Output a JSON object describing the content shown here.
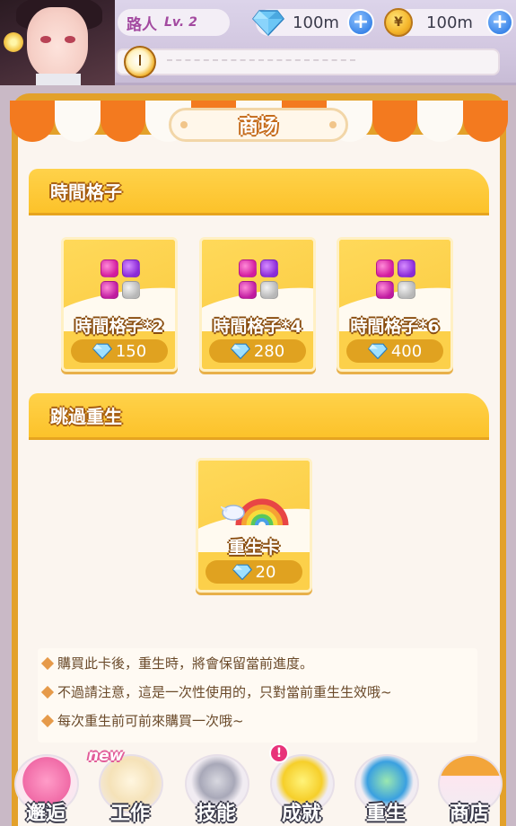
{
  "header": {
    "player_name": "路人",
    "level": "Lv. 2",
    "gems": "100m",
    "coins": "100m"
  },
  "shop": {
    "title": "商场",
    "sections": [
      {
        "title": "時間格子",
        "items": [
          {
            "name": "時間格子*2",
            "price": "150"
          },
          {
            "name": "時間格子*4",
            "price": "280"
          },
          {
            "name": "時間格子*6",
            "price": "400"
          }
        ]
      },
      {
        "title": "跳過重生",
        "items": [
          {
            "name": "重生卡",
            "price": "20"
          }
        ]
      }
    ],
    "notes": [
      "購買此卡後，重生時，將會保留當前進度。",
      "不過請注意，這是一次性使用的，只對當前重生生效哦~",
      "每次重生前可前來購買一次哦~"
    ]
  },
  "nav": {
    "items": [
      {
        "label": "邂逅",
        "icon": "hearts-icon"
      },
      {
        "label": "工作",
        "icon": "notepad-icon",
        "tag": "new"
      },
      {
        "label": "技能",
        "icon": "microphone-icon"
      },
      {
        "label": "成就",
        "icon": "star-icon",
        "alert": "!"
      },
      {
        "label": "重生",
        "icon": "refresh-icon"
      },
      {
        "label": "商店",
        "icon": "shop-icon"
      }
    ]
  },
  "colors": {
    "awning_orange": "#f37a1f",
    "section_yellow": "#fcc22a",
    "card_yellow": "#fcd04a",
    "price_pill": "#e0a220",
    "plus_blue": "#3c86e8",
    "name_purple": "#a34aa0"
  }
}
